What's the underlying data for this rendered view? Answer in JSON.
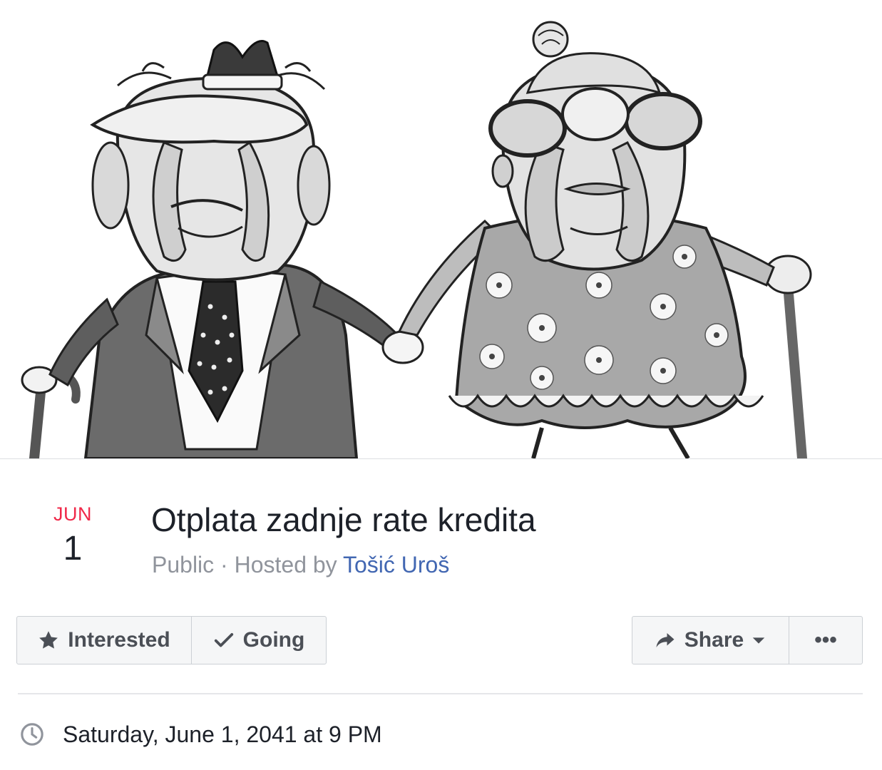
{
  "cover": {
    "image": "cartoon-elderly-couple-holding-hands"
  },
  "event": {
    "month": "JUN",
    "day": "1",
    "title": "Otplata zadnje rate kredita",
    "privacy": "Public",
    "hosted_by_label": "Hosted by",
    "host": "Tošić Uroš",
    "datetime": "Saturday, June 1, 2041 at 9 PM"
  },
  "actions": {
    "interested": "Interested",
    "going": "Going",
    "share": "Share",
    "more": "•••"
  },
  "icons": {
    "interested": "star-icon",
    "going": "checkmark-icon",
    "share": "share-arrow-icon",
    "share_menu": "caret-down-icon",
    "time": "clock-icon"
  },
  "colors": {
    "month": "#f02849",
    "link": "#4267b2",
    "meta": "#90949c",
    "button_bg": "#f5f6f7"
  }
}
